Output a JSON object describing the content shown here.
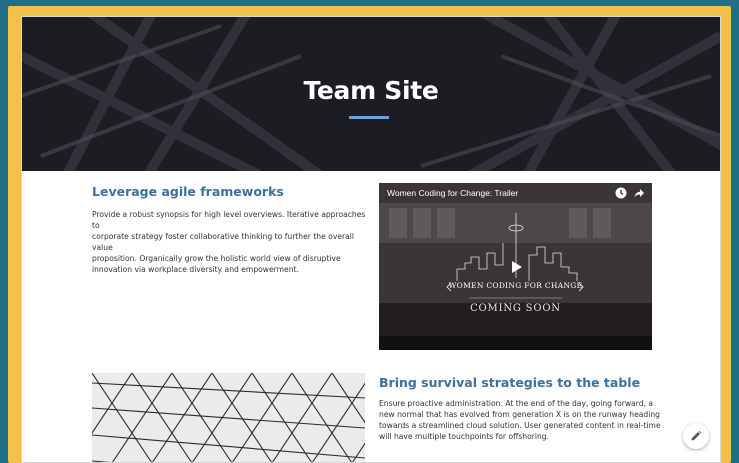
{
  "hero": {
    "title": "Team Site"
  },
  "section1": {
    "heading": "Leverage agile frameworks",
    "body_lines": [
      "Provide a robust synopsis for high level overviews. Iterative approaches to",
      "corporate strategy foster collaborative thinking to further the overall value",
      "proposition. Organically grow the holistic world view of disruptive",
      "innovation via workplace diversity and empowerment."
    ]
  },
  "video": {
    "title": "Women Coding for Change: Trailer",
    "brand": "WOMEN CODING FOR CHANGE",
    "coming_soon": "COMING SOON",
    "icons": [
      "clock-icon",
      "share-icon",
      "play-icon"
    ]
  },
  "section2": {
    "heading": "Bring survival strategies to the table",
    "body_lines": [
      "Ensure proactive administration. At the end of the day, going forward, a",
      "new normal that has evolved from generation X is on the runway heading",
      "towards a streamlined cloud solution. User generated content in real-time",
      "will have multiple touchpoints for offshoring."
    ]
  },
  "colors": {
    "background": "#1f6f86",
    "frame": "#f3c04a",
    "heading": "#3d6fa0",
    "accent_underline": "#6fa0d6"
  },
  "edit_button": {
    "icon": "pencil-icon"
  }
}
